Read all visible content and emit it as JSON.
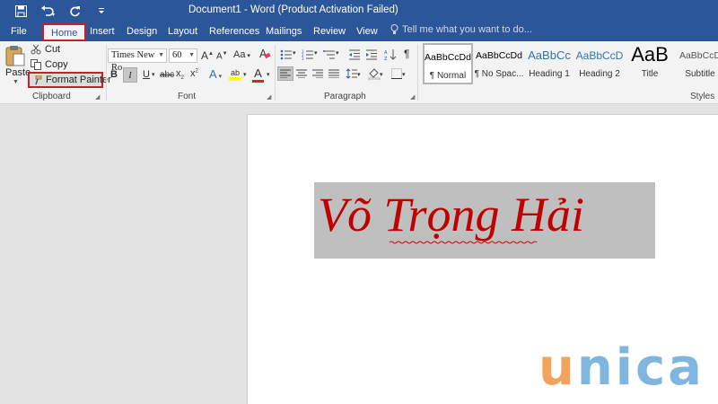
{
  "window": {
    "title": "Document1 - Word (Product Activation Failed)"
  },
  "tabs": [
    {
      "label": "File"
    },
    {
      "label": "Home",
      "active": true
    },
    {
      "label": "Insert"
    },
    {
      "label": "Design"
    },
    {
      "label": "Layout"
    },
    {
      "label": "References"
    },
    {
      "label": "Mailings"
    },
    {
      "label": "Review"
    },
    {
      "label": "View"
    }
  ],
  "tell_me": {
    "placeholder": "Tell me what you want to do..."
  },
  "clipboard": {
    "paste_label": "Paste",
    "cut_label": "Cut",
    "copy_label": "Copy",
    "format_painter_label": "Format Painter",
    "group_label": "Clipboard"
  },
  "font": {
    "name": "Times New Ro",
    "size": "60",
    "grow_label": "A",
    "shrink_label": "A",
    "case_label": "Aa",
    "bold": "B",
    "italic": "I",
    "underline": "U",
    "strike": "abc",
    "subscript": "x",
    "superscript": "x",
    "text_effects": "A",
    "highlight": "ab",
    "font_color": "A",
    "group_label": "Font"
  },
  "paragraph": {
    "group_label": "Paragraph",
    "show_marks": "¶"
  },
  "styles": {
    "group_label": "Styles",
    "items": [
      {
        "preview": "AaBbCcDd",
        "name": "¶ Normal",
        "selected": true
      },
      {
        "preview": "AaBbCcDd",
        "name": "¶ No Spac..."
      },
      {
        "preview": "AaBbCc",
        "name": "Heading 1"
      },
      {
        "preview": "AaBbCcD",
        "name": "Heading 2"
      },
      {
        "preview": "AaB",
        "name": "Title"
      },
      {
        "preview": "AaBbCcD",
        "name": "Subtitle"
      }
    ]
  },
  "document": {
    "text": "Võ Trọng Hải",
    "text_color": "#c00000",
    "highlight_color": "#bfbfbf"
  },
  "watermark": {
    "u": "u",
    "rest": "nica"
  },
  "colors": {
    "accent": "#2b579a",
    "highlight_outline": "#c8202a"
  }
}
